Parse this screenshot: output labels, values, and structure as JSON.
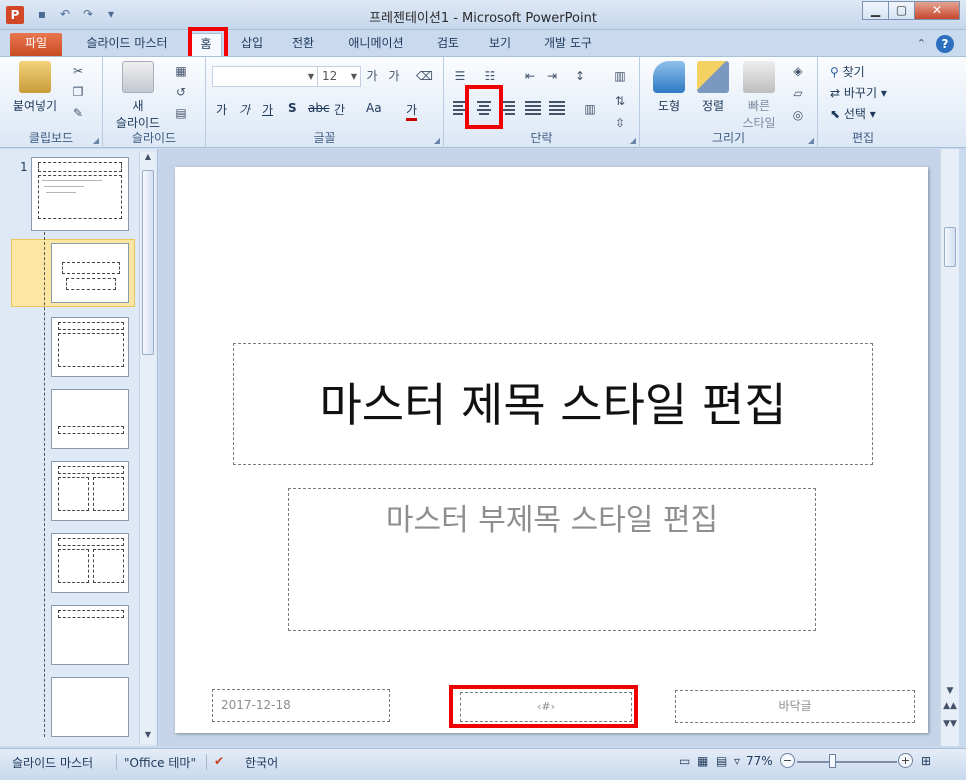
{
  "window": {
    "title": "프레젠테이션1 - Microsoft PowerPoint",
    "app_icon": "P",
    "buttons": {
      "minimize": "▁",
      "maximize": "▢",
      "close": "✕"
    }
  },
  "qat": {
    "icons": [
      "save-icon",
      "undo-icon",
      "redo-icon",
      "customize-icon"
    ]
  },
  "tabs": [
    {
      "label": "파일"
    },
    {
      "label": "슬라이드 마스터"
    },
    {
      "label": "홈"
    },
    {
      "label": "삽입"
    },
    {
      "label": "전환"
    },
    {
      "label": "애니메이션"
    },
    {
      "label": "검토"
    },
    {
      "label": "보기"
    },
    {
      "label": "개발 도구"
    }
  ],
  "ribbon": {
    "clipboard": {
      "paste": "붙여넣기",
      "label": "클립보드"
    },
    "slides": {
      "new_slide_line1": "새",
      "new_slide_line2": "슬라이드",
      "label": "슬라이드"
    },
    "font": {
      "font_name": "",
      "font_size": "12",
      "label": "글꼴",
      "bold": "가",
      "italic": "가",
      "underline": "가",
      "shadow": "S",
      "strike": "abc",
      "spacing": "간",
      "case": "Aa",
      "color": "가"
    },
    "paragraph": {
      "label": "단락"
    },
    "drawing": {
      "shapes": "도형",
      "arrange": "정렬",
      "quick_styles_line1": "빠른",
      "quick_styles_line2": "스타일",
      "label": "그리기"
    },
    "editing": {
      "find": "찾기",
      "replace": "바꾸기",
      "select": "선택",
      "label": "편집"
    }
  },
  "thumbnails": {
    "first_number": "1",
    "title_snippet": "마스터 제목 스타일 편집"
  },
  "slide": {
    "title": "마스터 제목 스타일 편집",
    "subtitle": "마스터 부제목 스타일 편집",
    "date": "2017-12-18",
    "number": "‹#›",
    "footer": "바닥글"
  },
  "status": {
    "view": "슬라이드 마스터",
    "theme": "\"Office 테마\"",
    "language": "한국어",
    "zoom": "77%"
  },
  "colors": {
    "highlight": "#f20000",
    "file_tab": "#d24726"
  }
}
